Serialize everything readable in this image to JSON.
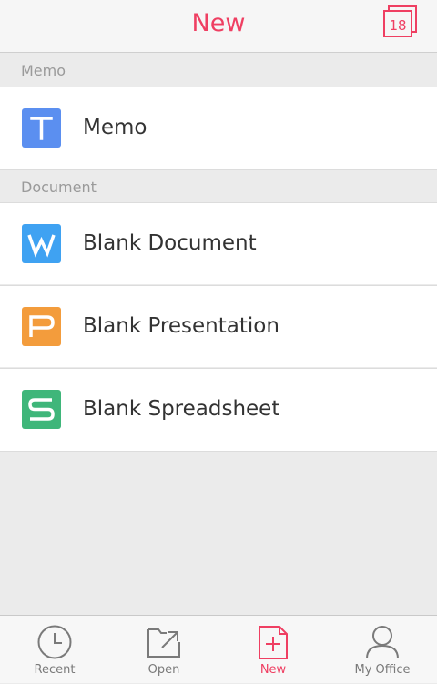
{
  "header": {
    "title": "New",
    "calendar_day": "18"
  },
  "sections": [
    {
      "title": "Memo",
      "items": [
        {
          "label": "Memo",
          "icon_letter": "T",
          "icon_color": "#5b8ff0",
          "icon": "memo-icon"
        }
      ]
    },
    {
      "title": "Document",
      "items": [
        {
          "label": "Blank Document",
          "icon_letter": "W",
          "icon_color": "#3fa2f2",
          "icon": "writer-icon"
        },
        {
          "label": "Blank Presentation",
          "icon_letter": "P",
          "icon_color": "#f39c3c",
          "icon": "presentation-icon"
        },
        {
          "label": "Blank Spreadsheet",
          "icon_letter": "S",
          "icon_color": "#3fb67a",
          "icon": "spreadsheet-icon"
        }
      ]
    }
  ],
  "tabbar": {
    "tabs": [
      {
        "label": "Recent",
        "icon": "clock-icon",
        "active": false
      },
      {
        "label": "Open",
        "icon": "open-folder-icon",
        "active": false
      },
      {
        "label": "New",
        "icon": "new-file-icon",
        "active": true
      },
      {
        "label": "My Office",
        "icon": "user-icon",
        "active": false
      }
    ]
  },
  "colors": {
    "accent": "#ef3f62",
    "inactive": "#7a7a7a"
  }
}
